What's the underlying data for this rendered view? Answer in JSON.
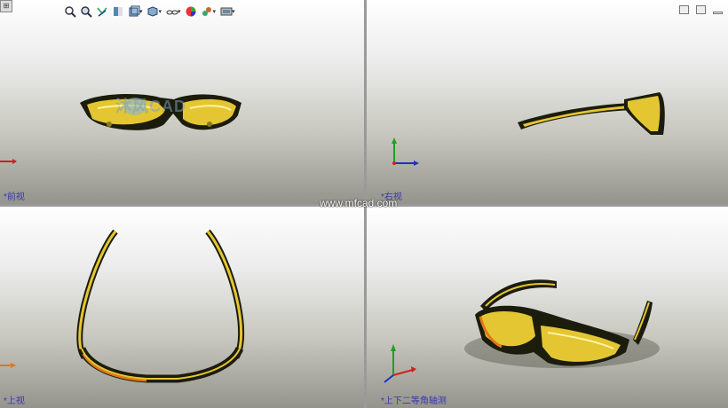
{
  "viewports": {
    "top_left": {
      "label": "*前视",
      "watermark": "沐风CAD"
    },
    "top_right": {
      "label": "*右视"
    },
    "bottom_left": {
      "label": "*上视"
    },
    "bottom_right": {
      "label": "*上下二等角轴测"
    }
  },
  "watermark_url": "www.mfcad.com",
  "toolbar_icons": [
    "zoom-to-fit-icon",
    "zoom-area-icon",
    "previous-view-icon",
    "section-view-icon",
    "view-orientation-icon",
    "display-style-icon",
    "hide-show-items-icon",
    "edit-appearance-icon",
    "apply-scene-icon",
    "view-settings-icon"
  ],
  "colors": {
    "lens": "#e8c830",
    "frame": "#1a1a0a",
    "orange": "#e07818",
    "axis_x": "#d02020",
    "axis_y": "#20a020",
    "axis_z": "#2030c0"
  }
}
